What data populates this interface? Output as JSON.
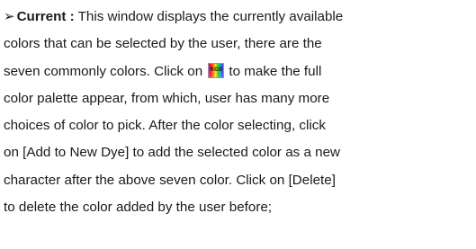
{
  "paragraph": {
    "bullet": "➢",
    "term": "Current :",
    "line1": " This window displays the currently available",
    "line2": "colors that can be selected by the user, there are the",
    "line3_before": "seven commonly colors. Click on ",
    "line3_after": "to make the full",
    "line4": "color palette appear, from which, user has many more",
    "line5": "choices of color to pick.  After the color selecting, click",
    "line6": "on [Add to New Dye] to add the selected color as a new",
    "line7": "character after the above seven color. Click on [Delete]",
    "line8": "to delete the color added by the user before;",
    "icon": {
      "name": "rgb-palette-icon",
      "label": "RGB",
      "colors": [
        "#e4008a",
        "#ff1f1f",
        "#ff8c00",
        "#ffe400",
        "#35c41b",
        "#00a9e6",
        "#5b2fd9"
      ]
    }
  }
}
